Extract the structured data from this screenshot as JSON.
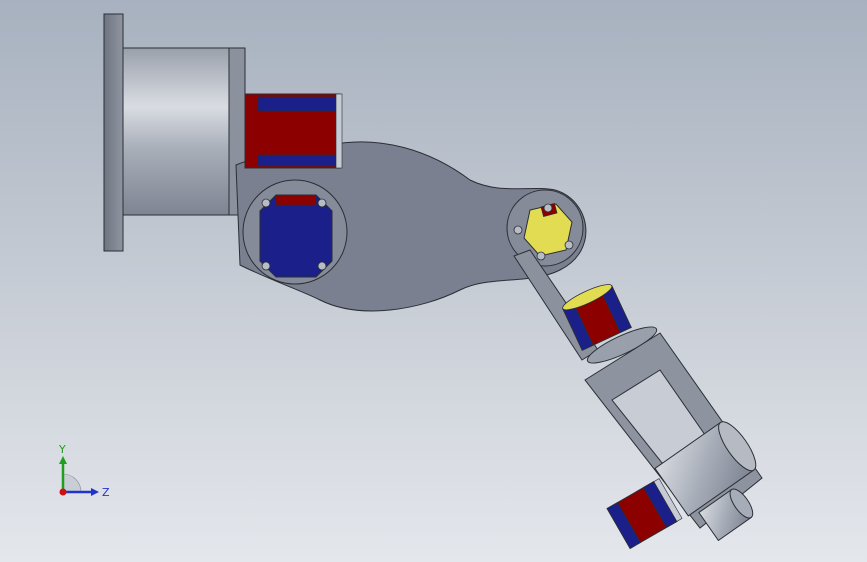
{
  "viewport": {
    "background_top": "#a7b1bf",
    "background_bottom": "#e4e7ec"
  },
  "model": {
    "colors": {
      "gray_body": "#7d8494",
      "gray_light": "#c6cbd4",
      "red": "#8c0000",
      "blue": "#1a1f8a",
      "yellow": "#e2dc52"
    }
  },
  "triad": {
    "y_label": "Y",
    "z_label": "Z",
    "y_color": "#1ea01e",
    "z_color": "#2233cc",
    "x_color": "#cc1111"
  }
}
